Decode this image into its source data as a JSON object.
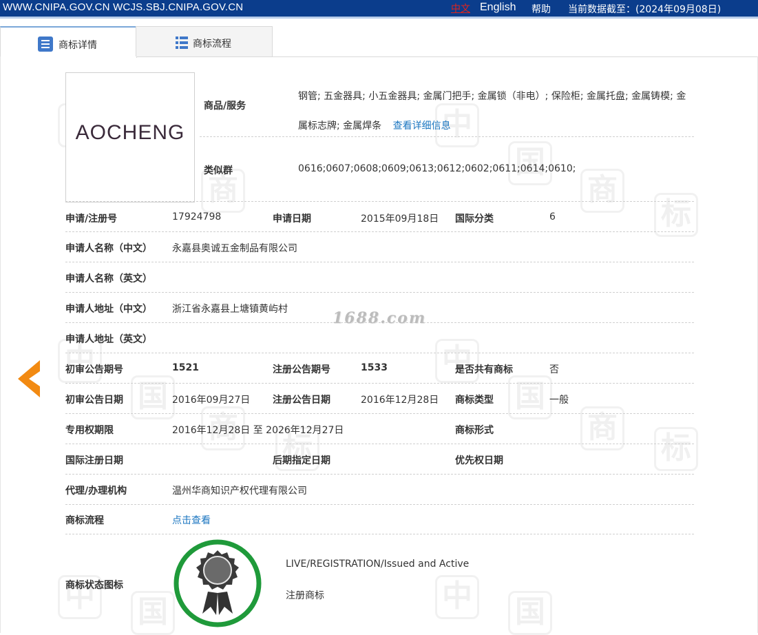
{
  "topbar": {
    "domains": "WWW.CNIPA.GOV.CN WCJS.SBJ.CNIPA.GOV.CN",
    "lang_zh": "中文",
    "lang_en": "English",
    "help": "帮助",
    "data_date": "当前数据截至：(2024年09月08日)"
  },
  "tabs": {
    "details": "商标详情",
    "process": "商标流程"
  },
  "trademark": {
    "logo_text": "AOCHENG",
    "goods_label": "商品/服务",
    "goods_value": "钢管; 五金器具; 小五金器具; 金属门把手; 金属锁（非电）; 保险柜; 金属托盘; 金属铸模; 金属标志牌; 金属焊条",
    "goods_more_link": "查看详细信息",
    "similar_group_label": "类似群",
    "similar_group_value": "0616;0607;0608;0609;0613;0612;0602;0611;0614;0610;"
  },
  "details": {
    "reg_no_label": "申请/注册号",
    "reg_no": "17924798",
    "apply_date_label": "申请日期",
    "apply_date": "2015年09月18日",
    "intl_class_label": "国际分类",
    "intl_class": "6",
    "applicant_cn_label": "申请人名称（中文）",
    "applicant_cn": "永嘉县奥诚五金制品有限公司",
    "applicant_en_label": "申请人名称（英文）",
    "applicant_en": "",
    "address_cn_label": "申请人地址（中文）",
    "address_cn": "浙江省永嘉县上塘镇黄屿村",
    "address_en_label": "申请人地址（英文）",
    "address_en": "",
    "prelim_no_label": "初审公告期号",
    "prelim_no": "1521",
    "reg_pub_no_label": "注册公告期号",
    "reg_pub_no": "1533",
    "shared_label": "是否共有商标",
    "shared": "否",
    "prelim_date_label": "初审公告日期",
    "prelim_date": "2016年09月27日",
    "reg_pub_date_label": "注册公告日期",
    "reg_pub_date": "2016年12月28日",
    "tm_type_label": "商标类型",
    "tm_type": "一般",
    "exclusive_label": "专用权期限",
    "exclusive": "2016年12月28日 至 2026年12月27日",
    "tm_form_label": "商标形式",
    "tm_form": "",
    "intl_reg_date_label": "国际注册日期",
    "later_designation_label": "后期指定日期",
    "priority_date_label": "优先权日期",
    "agent_label": "代理/办理机构",
    "agent": "温州华商知识产权代理有限公司",
    "process_label": "商标流程",
    "process_link": "点击查看",
    "status_icon_label": "商标状态图标",
    "status_en": "LIVE/REGISTRATION/Issued and Active",
    "status_cn": "注册商标"
  },
  "overlay": {
    "site_watermark": "1688.com"
  },
  "colors": {
    "topbar_bg": "#0b3d8c",
    "link": "#1b76c0",
    "nav_arrow": "#f28a12",
    "status_ring": "#1f9a3a"
  }
}
